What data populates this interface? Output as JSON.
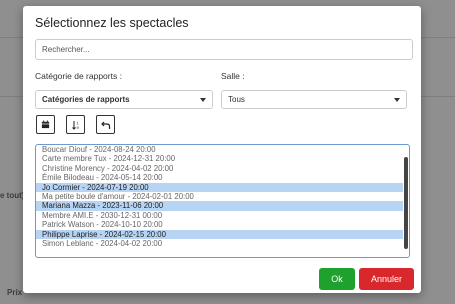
{
  "background": {
    "left_text": "e tout)",
    "bottom_text": "Prix"
  },
  "dialog": {
    "title": "Sélectionnez les spectacles",
    "search_placeholder": "Rechercher...",
    "category_label": "Catégorie de rapports :",
    "category_value": "Catégories de rapports",
    "room_label": "Salle :",
    "room_value": "Tous",
    "toolbar_icons": [
      "calendar-icon",
      "sort-icon",
      "undo-icon"
    ],
    "list_items": [
      {
        "text": "Boucar Diouf - 2024-08-24 20:00",
        "selected": false
      },
      {
        "text": "Carte membre Tux - 2024-12-31 20:00",
        "selected": false
      },
      {
        "text": "Christine Morency - 2024-04-02 20:00",
        "selected": false
      },
      {
        "text": "Émile Bilodeau - 2024-05-14 20:00",
        "selected": false
      },
      {
        "text": "Jo Cormier - 2024-07-19 20:00",
        "selected": true
      },
      {
        "text": "Ma petite boule d'amour - 2024-02-01 20:00",
        "selected": false
      },
      {
        "text": "Mariana Mazza - 2023-11-06 20:00",
        "selected": true
      },
      {
        "text": "Membre AMI.E - 2030-12-31 00:00",
        "selected": false
      },
      {
        "text": "Patrick Watson - 2024-10-10 20:00",
        "selected": false
      },
      {
        "text": "Philippe Laprise - 2024-02-15 20:00",
        "selected": true
      },
      {
        "text": "Simon Leblanc - 2024-04-02 20:00",
        "selected": false
      }
    ],
    "ok_label": "Ok",
    "cancel_label": "Annuler",
    "ok_color": "#1fa12e",
    "cancel_color": "#d9282c"
  }
}
